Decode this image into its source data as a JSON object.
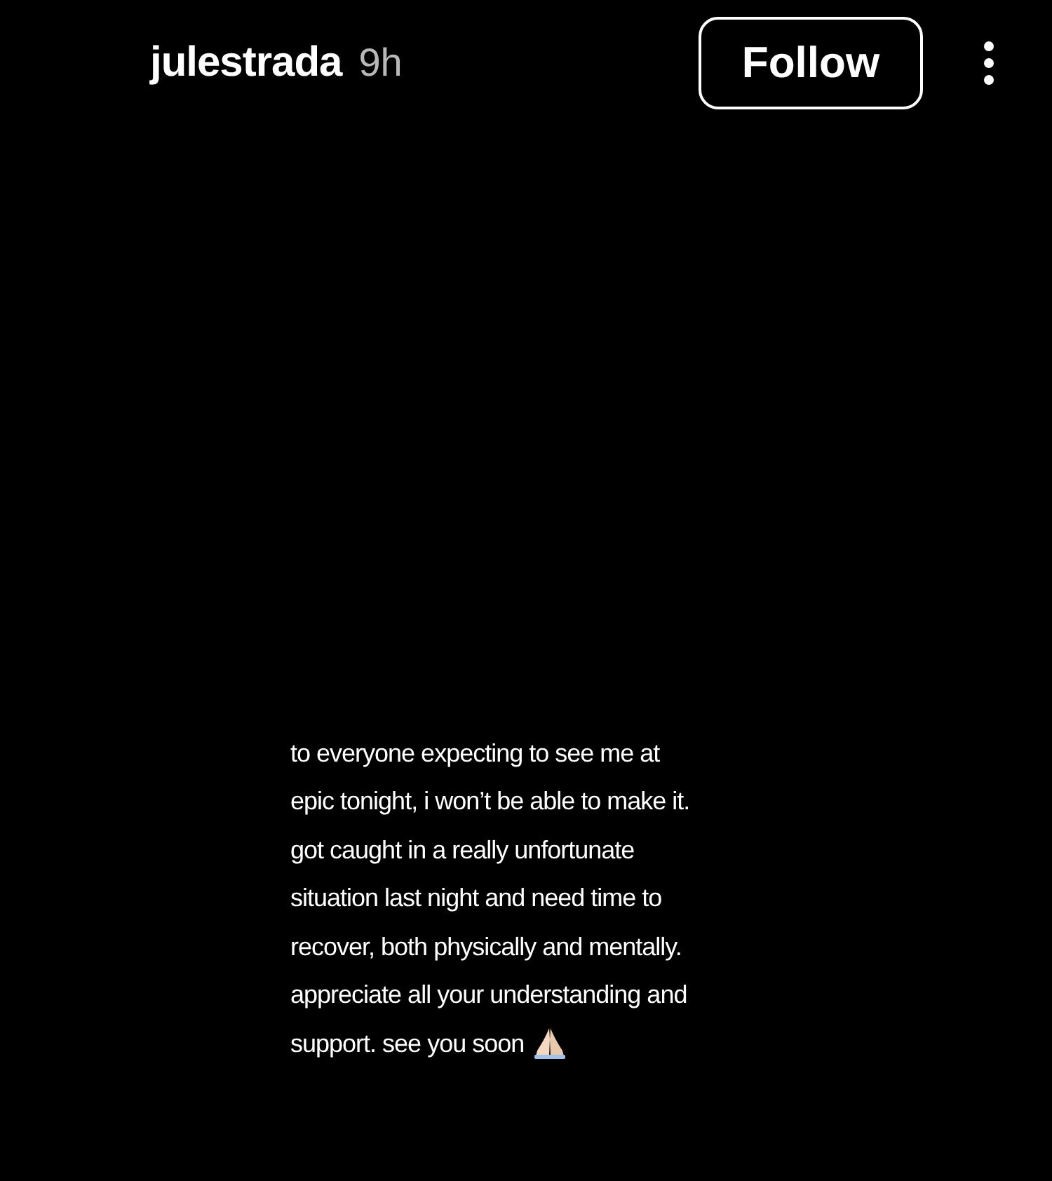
{
  "header": {
    "username": "julestrada",
    "time": "9h",
    "follow_button": "Follow"
  },
  "story": {
    "lines": [
      "to everyone expecting to see me at",
      "epic tonight, i won’t be able to make it.",
      "got caught in a really unfortunate",
      "situation last night and need time to",
      "recover, both physically and mentally.",
      "appreciate all your understanding and",
      "support. see you soon"
    ]
  }
}
